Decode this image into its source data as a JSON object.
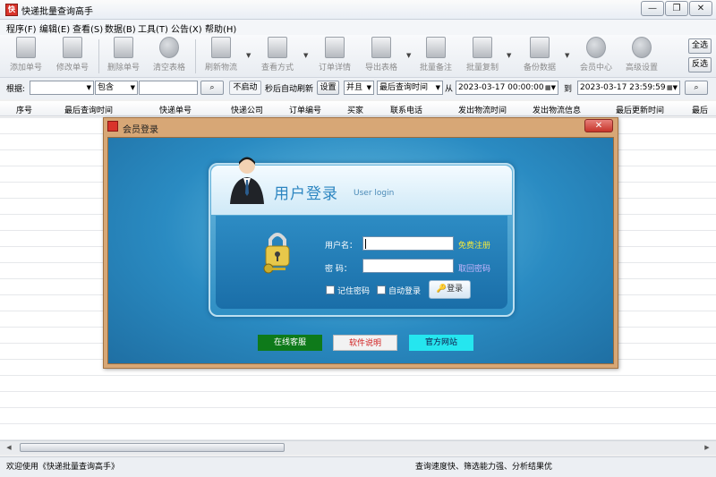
{
  "window": {
    "title": "快递批量查询高手",
    "controls": [
      "—",
      "❐",
      "✕"
    ]
  },
  "menu": [
    "程序(F)",
    "编辑(E)",
    "查看(S)",
    "数据(B)",
    "工具(T)",
    "公告(X)",
    "帮助(H)"
  ],
  "toolbar": {
    "buttons": [
      {
        "label": "添加单号",
        "icon": "document-icon"
      },
      {
        "label": "修改单号",
        "icon": "edit-icon"
      },
      {
        "label": "删除单号",
        "icon": "delete-icon"
      },
      {
        "label": "清空表格",
        "icon": "clear-icon"
      },
      {
        "label": "刷新物流",
        "icon": "refresh-icon"
      },
      {
        "label": "查看方式",
        "icon": "view-icon"
      },
      {
        "label": "订单详情",
        "icon": "order-icon"
      },
      {
        "label": "导出表格",
        "icon": "export-icon"
      },
      {
        "label": "批量备注",
        "icon": "note-icon"
      },
      {
        "label": "批量复制",
        "icon": "copy-icon"
      },
      {
        "label": "备份数据",
        "icon": "backup-icon"
      },
      {
        "label": "会员中心",
        "icon": "clock-icon"
      },
      {
        "label": "高级设置",
        "icon": "gear-icon"
      }
    ],
    "select_all": "全选",
    "invert": "反选"
  },
  "filter": {
    "basis_label": "根据:",
    "basis_value": "",
    "match_value": "包含",
    "search_value": "",
    "not_started": "不启动",
    "auto_refresh_hint": "秒后自动刷新",
    "settings": "设置",
    "logic": "并且",
    "date_field": "最后查询时间",
    "from_label": "从",
    "from_value": "2023-03-17 00:00:00",
    "to_label": "到",
    "to_value": "2023-03-17 23:59:59"
  },
  "table": {
    "columns": [
      "序号",
      "最后查询时间",
      "快递单号",
      "快递公司",
      "订单编号",
      "买家",
      "联系电话",
      "发出物流时间",
      "发出物流信息",
      "最后更新时间",
      "最后"
    ]
  },
  "status": {
    "left": "欢迎使用《快递批量查询高手》",
    "right": "查询速度快、筛选能力强、分析结果优"
  },
  "dialog": {
    "title": "会员登录",
    "heading": "用户登录",
    "heading_en": "User login",
    "username_label": "用户名：",
    "password_label": "密  码：",
    "username_value": "",
    "password_value": "",
    "register_link": "免费注册",
    "recover_link": "取回密码",
    "remember_label": "记住密码",
    "auto_login_label": "自动登录",
    "login_button": "登录",
    "support_button": "在线客服",
    "manual_button": "软件说明",
    "website_button": "官方网站"
  },
  "colors": {
    "support_bg": "#0e7a1a",
    "manual_bg": "#f2f2f2",
    "website_bg": "#25e6ef",
    "register_link": "#f5e93a",
    "recover_link": "#c9b6ff"
  }
}
